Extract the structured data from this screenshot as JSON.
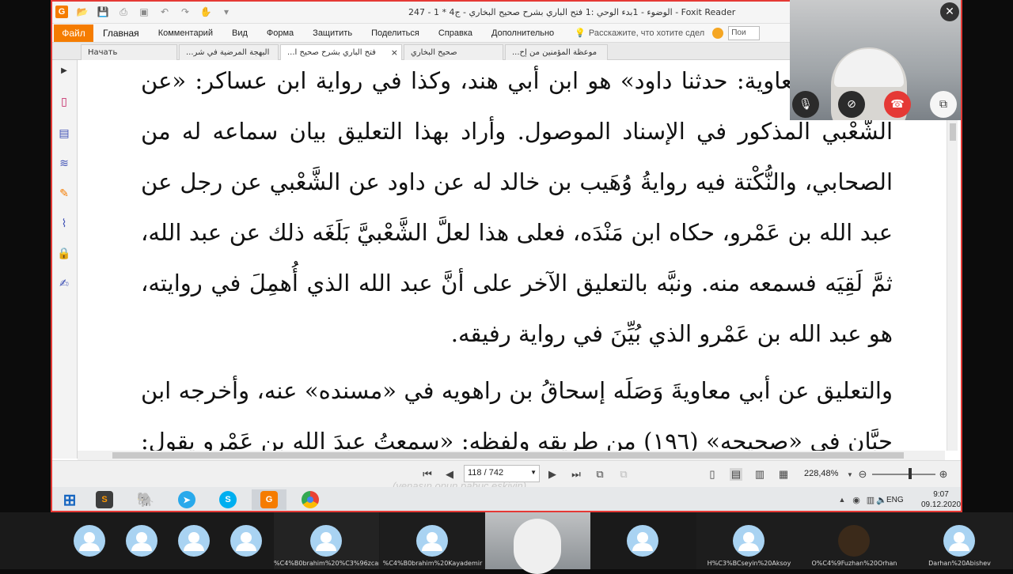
{
  "app": {
    "window_title": "247 - 1 * 4الوضوء - 1بدء الوحي :1 فتح الباري بشرح صحيح البخاري - ج - Foxit Reader"
  },
  "menu": {
    "file": "Файл",
    "items": [
      "Главная",
      "Комментарий",
      "Вид",
      "Форма",
      "Защитить",
      "Поделиться",
      "Справка",
      "Дополнительно"
    ],
    "tellme": "Расскажите, что хотите сдел",
    "search_placeholder": "Пои"
  },
  "doc_tabs": [
    {
      "label": "Начать"
    },
    {
      "label": "...البهجة المرضية في شر"
    },
    {
      "label": "...فتح الباري بشرح صحيح ا"
    },
    {
      "label": "صحيح البخاري"
    },
    {
      "label": "...موعظة المؤمنين من إح"
    }
  ],
  "document": {
    "paragraphs": [
      "وقال أبو معاوية: حدثنا داود» هو ابن أبي هند، وكذا في رواية ابن عساكر: «عن الشَّعْبي المذكور في الإسناد الموصول. وأراد بهذا التعليق بيان سماعه له من الصحابي، والنُّكْتة فيه روايةُ وُهَيب بن خالد له عن داود عن الشَّعْبي عن رجل عن عبد الله بن عَمْرو، حكاه ابن مَنْدَه، فعلى هذا لعلَّ الشَّعْبيَّ بَلَغَه ذلك عن عبد الله، ثمَّ لَقِيَه فسمعه منه. ونبَّه بالتعليق الآخر على أنَّ عبد الله الذي أُهمِلَ في روايته، هو عبد الله بن عَمْرو الذي بُيِّنَ في رواية رفيقه.",
      "والتعليق عن أبي معاويةَ وَصَلَه إسحاقُ بن راهويه في «مسنده» عنه، وأخرجه ابن حِبَّان في «صحيحه» (١٩٦) من طريقه ولفظه: «سمعتُ عبدَ الله بن عَمْرو يقول: وربِّ"
    ]
  },
  "status": {
    "page": "118 / 742",
    "zoom": "228,48%",
    "watermark": "(venasın onun pabuç eskiyin)"
  },
  "taskbar": {
    "lang": "ENG",
    "time": "9:07",
    "date": "09.12.2020"
  },
  "meeting": {
    "participants": [
      {
        "name": ""
      },
      {
        "name": ""
      },
      {
        "name": ""
      },
      {
        "name": ""
      },
      {
        "name": "%C4%B0brahim%20%C3%96zcan"
      },
      {
        "name": "%C4%B0brahim%20Kayademir"
      },
      {
        "name": ""
      },
      {
        "name": "H%C3%BCseyin%20Aksoy"
      },
      {
        "name": "O%C4%9Fuzhan%20Orhan"
      },
      {
        "name": "Darhan%20Abishev"
      }
    ]
  },
  "colors": {
    "accent": "#f57c00",
    "frame": "#e53935",
    "avatar": "#a9d3f2",
    "hangup": "#e53935"
  }
}
